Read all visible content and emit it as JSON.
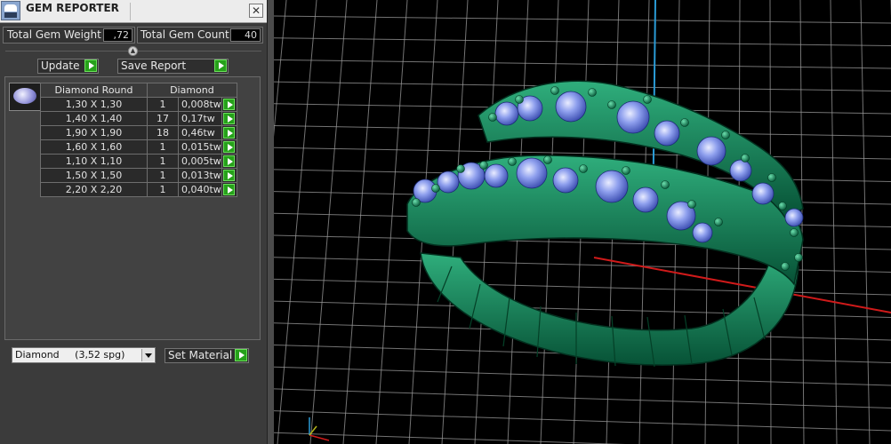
{
  "window": {
    "title": "GEM REPORTER",
    "close_glyph": "✕"
  },
  "summary": {
    "total_weight_label": "Total Gem Weight",
    "total_weight_value": ",72",
    "total_count_label": "Total Gem Count",
    "total_count_value": "40"
  },
  "actions": {
    "update_label": "Update",
    "save_report_label": "Save Report"
  },
  "table": {
    "headers": [
      "Diamond Round",
      "Diamond"
    ],
    "rows": [
      {
        "size": "1,30 X 1,30",
        "count": "1",
        "weight": "0,008tw"
      },
      {
        "size": "1,40 X 1,40",
        "count": "17",
        "weight": "0,17tw"
      },
      {
        "size": "1,90 X 1,90",
        "count": "18",
        "weight": "0,46tw"
      },
      {
        "size": "1,60 X 1,60",
        "count": "1",
        "weight": "0,015tw"
      },
      {
        "size": "1,10 X 1,10",
        "count": "1",
        "weight": "0,005tw"
      },
      {
        "size": "1,50 X 1,50",
        "count": "1",
        "weight": "0,013tw"
      },
      {
        "size": "2,20 X 2,20",
        "count": "1",
        "weight": "0,040tw"
      }
    ]
  },
  "material": {
    "selected": "Diamond     (3,52 spg)",
    "set_label": "Set Material"
  },
  "colors": {
    "panel": "#3b3b3b",
    "go_button": "#26a11a",
    "ring_metal": "#0f7a52",
    "gem": "#7b8fe6",
    "grid": "#9a9a9a",
    "axis_x": "#d01a1a",
    "axis_y": "#2a9bd6"
  },
  "icons": {
    "app": "gem-reporter-app-icon",
    "close": "close-icon",
    "go": "play-arrow-icon",
    "collapse": "collapse-chevron-icon",
    "dropdown": "chevron-down-icon",
    "thumb": "round-gem-icon"
  }
}
